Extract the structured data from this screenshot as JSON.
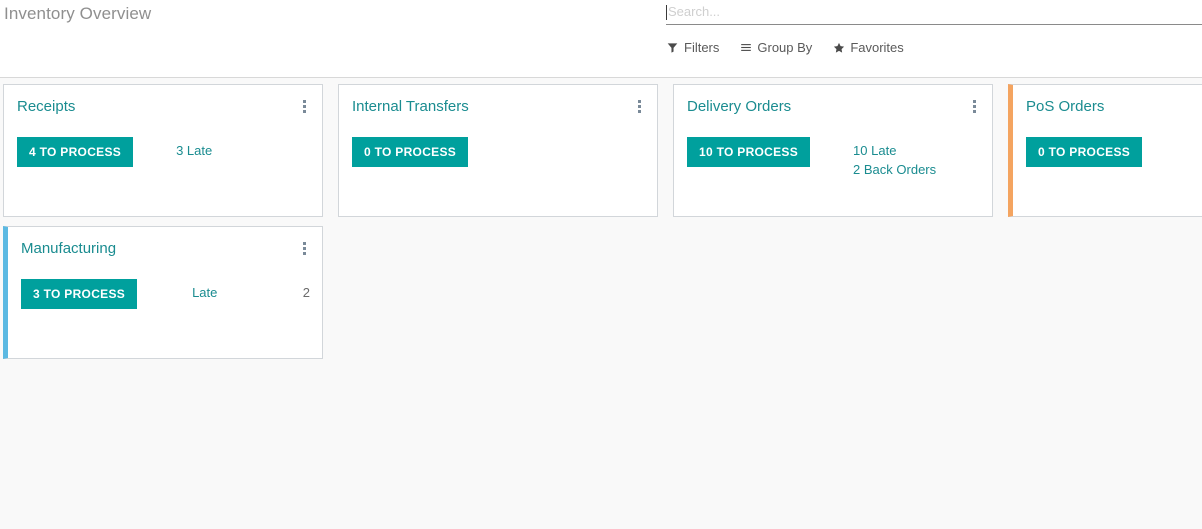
{
  "breadcrumb": "Inventory Overview",
  "search": {
    "placeholder": "Search...",
    "value": ""
  },
  "search_buttons": [
    {
      "label": "Filters",
      "icon": "filter-icon"
    },
    {
      "label": "Group By",
      "icon": "list-icon"
    },
    {
      "label": "Favorites",
      "icon": "star-icon"
    }
  ],
  "colors": {
    "primary_teal": "#00a09d",
    "title_teal": "#1a8c90",
    "accent_blue": "#5cb9e2",
    "accent_orange": "#f4a460",
    "background": "#f9f9f9",
    "card_background": "#ffffff",
    "card_border": "#d2d6da"
  },
  "cards": [
    {
      "title": "Receipts",
      "button_label": "4 TO PROCESS",
      "accent": "none",
      "aside_lines": [
        "3 Late"
      ],
      "aside_rows": []
    },
    {
      "title": "Internal Transfers",
      "button_label": "0 TO PROCESS",
      "accent": "none",
      "aside_lines": [],
      "aside_rows": []
    },
    {
      "title": "Delivery Orders",
      "button_label": "10 TO PROCESS",
      "accent": "none",
      "aside_lines": [
        "10 Late",
        "2 Back Orders"
      ],
      "aside_rows": []
    },
    {
      "title": "PoS Orders",
      "button_label": "0 TO PROCESS",
      "accent": "orange",
      "aside_lines": [],
      "aside_rows": []
    },
    {
      "title": "Manufacturing",
      "button_label": "3 TO PROCESS",
      "accent": "blue",
      "aside_lines": [],
      "aside_rows": [
        {
          "key": "Late",
          "value": "2"
        }
      ]
    }
  ]
}
